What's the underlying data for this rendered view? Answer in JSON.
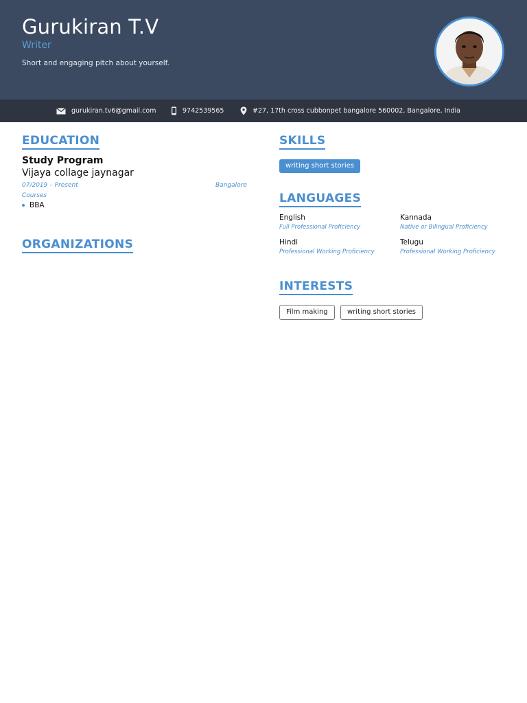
{
  "header": {
    "name": "Gurukiran T.V",
    "role": "Writer",
    "pitch": "Short and engaging pitch about yourself."
  },
  "contact": {
    "email": "gurukiran.tv6@gmail.com",
    "phone": "9742539565",
    "address": "#27, 17th cross cubbonpet bangalore 560002, Bangalore, India",
    "icons": [
      "envelope-icon",
      "phone-icon",
      "location-pin-icon"
    ]
  },
  "education": {
    "title": "EDUCATION",
    "degree": "Study Program",
    "school": "Vijaya collage jaynagar",
    "dates": "07/2019 – Present",
    "location": "Bangalore",
    "courses_label": "Courses",
    "courses": [
      "BBA"
    ]
  },
  "organizations": {
    "title": "ORGANIZATIONS"
  },
  "skills": {
    "title": "SKILLS",
    "items": [
      "writing short stories"
    ]
  },
  "languages": {
    "title": "LANGUAGES",
    "items": [
      {
        "name": "English",
        "level": "Full Professional Proficiency"
      },
      {
        "name": "Kannada",
        "level": "Native or Bilingual Proficiency"
      },
      {
        "name": "Hindi",
        "level": "Professional Working Proficiency"
      },
      {
        "name": "Telugu",
        "level": "Professional Working Proficiency"
      }
    ]
  },
  "interests": {
    "title": "INTERESTS",
    "items": [
      "Film making",
      "writing short stories"
    ]
  },
  "colors": {
    "header_bg": "#3b4a61",
    "contact_bar_bg": "#2f3540",
    "accent": "#4a8fd0"
  }
}
